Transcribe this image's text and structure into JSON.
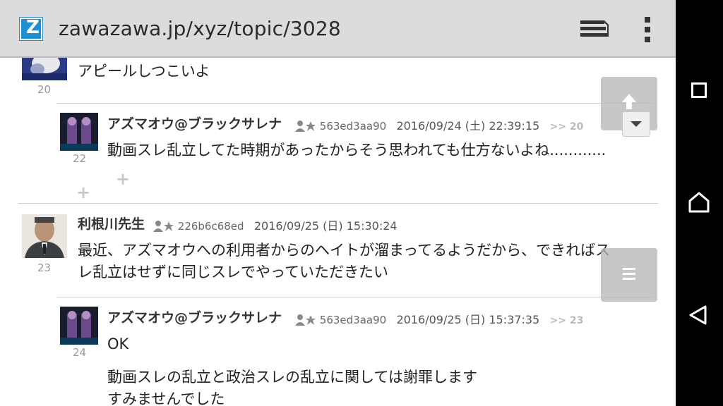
{
  "browser": {
    "url": "zawazawa.jp/xyz/topic/3028",
    "favicon_letter": "Z",
    "tabs_icon": "tabs-stack-icon",
    "menu_icon": "overflow-menu-icon"
  },
  "posts": [
    {
      "number": "20",
      "body": "アピールしつこいよ"
    },
    {
      "number": "22",
      "name": "アズマオウ@ブラックサレナ",
      "user_id": "563ed3aa90",
      "date": "2016/09/24 (土) 22:39:15",
      "reply_to": ">> 20",
      "body": "動画スレ乱立してた時期があったからそう思われても仕方ないよね............"
    },
    {
      "number": "23",
      "name": "利根川先生",
      "user_id": "226b6c68ed",
      "date": "2016/09/25 (日) 15:30:24",
      "body_line1": "最近、アズマオウへの利用者からのヘイトが溜まってるようだから、できればス",
      "body_line2": "レ乱立はせずに同じスレでやっていただきたい"
    },
    {
      "number": "24",
      "name": "アズマオウ@ブラックサレナ",
      "user_id": "563ed3aa90",
      "date": "2016/09/25 (日) 15:37:35",
      "reply_to": ">> 23",
      "body_line1": "OK",
      "body_line2": "動画スレの乱立と政治スレの乱立に関しては謝罪します",
      "body_line3": "すみませんでした"
    }
  ],
  "floating_buttons": {
    "scroll_top": "arrow-up-icon",
    "expand": "chevron-down-icon",
    "menu": "hamburger-icon"
  },
  "android_nav": {
    "recents": "square-icon",
    "home": "home-icon",
    "back": "back-triangle-icon"
  }
}
